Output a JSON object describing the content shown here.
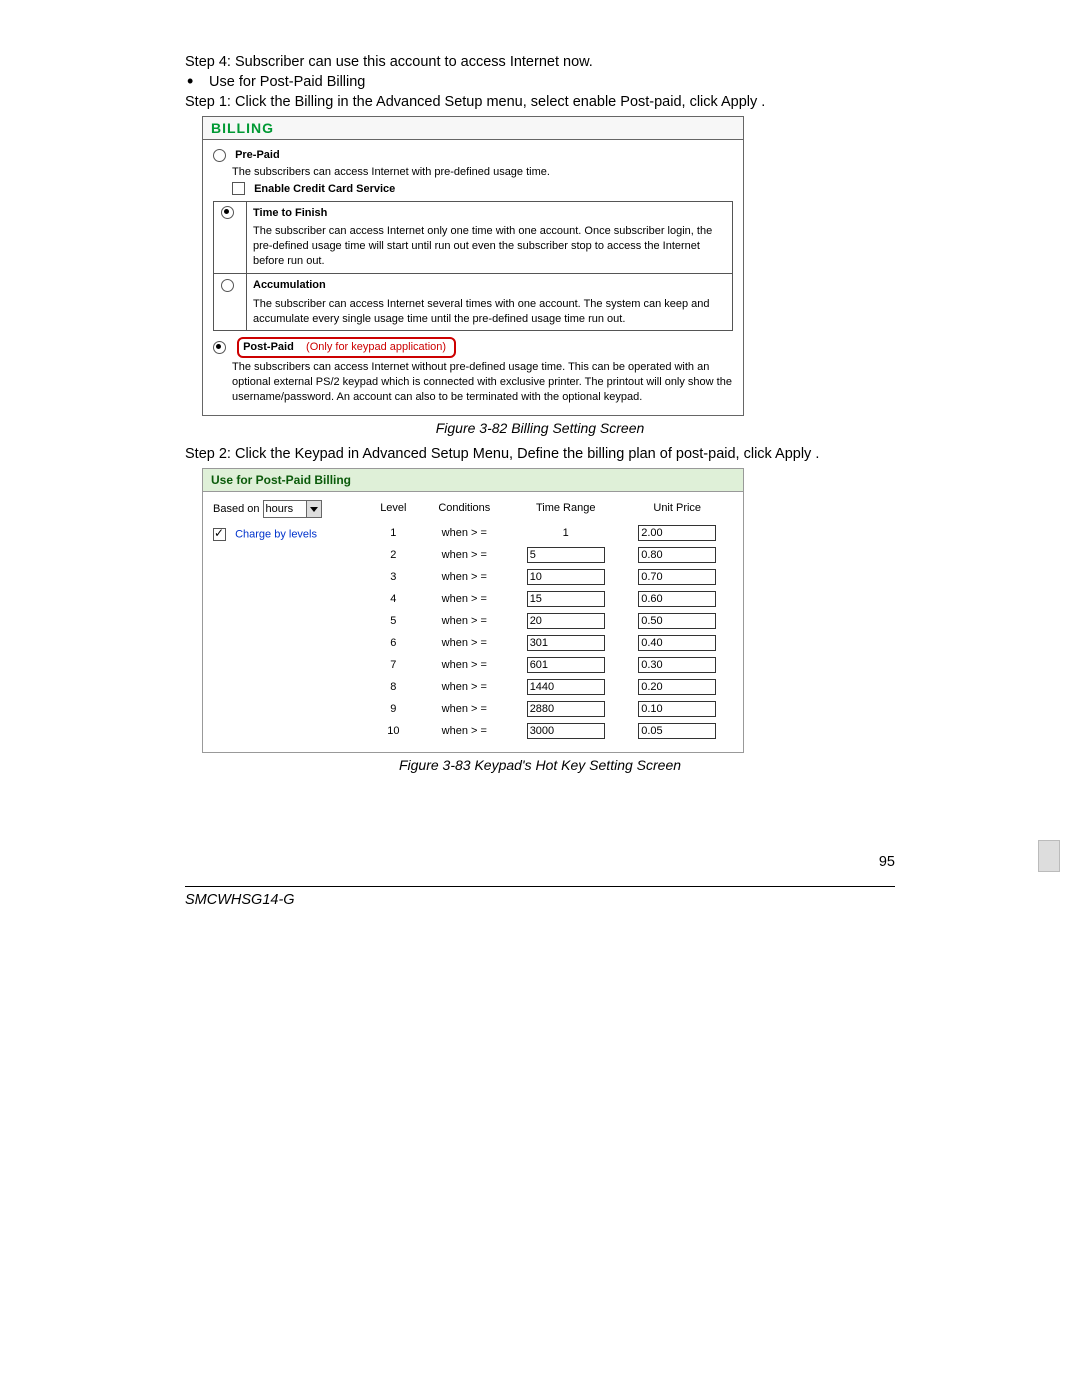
{
  "intro": {
    "step4": "Step 4: Subscriber can use this account to access Internet now.",
    "bullet": "Use for Post-Paid Billing",
    "step1": "Step 1: Click the Billing in the Advanced Setup menu, select enable Post-paid, click Apply ."
  },
  "billing": {
    "header": "BILLING",
    "prepaid_label": "Pre-Paid",
    "prepaid_desc": "The subscribers can access Internet with pre-defined usage time.",
    "enable_cc": "Enable Credit Card Service",
    "options": [
      {
        "title": "Time to Finish",
        "selected": true,
        "desc": "The subscriber can access Internet only one time with one account.  Once subscriber login, the pre-defined usage time will start until run out even the subscriber stop to access the Internet before run out."
      },
      {
        "title": "Accumulation",
        "selected": false,
        "desc": "The subscriber can access Internet several times with one account.  The system can keep and accumulate every single usage time until the pre-defined usage time run out."
      }
    ],
    "postpaid_label": "Post-Paid",
    "postpaid_note": "(Only for keypad application)",
    "postpaid_desc": "The subscribers can access Internet without pre-defined usage time. This can be operated with an optional external PS/2 keypad which is connected with exclusive printer. The printout will only show the username/password. An account can also to be terminated with the optional keypad."
  },
  "fig82": "Figure 3-82 Billing Setting Screen",
  "step2": "Step 2: Click the Keypad in Advanced Setup Menu, Define the billing plan of post-paid, click Apply .",
  "keypad": {
    "header": "Use for Post-Paid Billing",
    "based_on_label": "Based on",
    "based_on_value": "hours",
    "charge_label": "Charge by levels",
    "cols": {
      "a": "Level",
      "b": "Conditions",
      "c": "Time Range",
      "d": "Unit Price"
    },
    "cond": "when  > =",
    "rows": [
      {
        "level": "1",
        "range": "1",
        "range_is_static": true,
        "price": "2.00"
      },
      {
        "level": "2",
        "range": "5",
        "range_is_static": false,
        "price": "0.80"
      },
      {
        "level": "3",
        "range": "10",
        "range_is_static": false,
        "price": "0.70"
      },
      {
        "level": "4",
        "range": "15",
        "range_is_static": false,
        "price": "0.60"
      },
      {
        "level": "5",
        "range": "20",
        "range_is_static": false,
        "price": "0.50"
      },
      {
        "level": "6",
        "range": "301",
        "range_is_static": false,
        "price": "0.40"
      },
      {
        "level": "7",
        "range": "601",
        "range_is_static": false,
        "price": "0.30"
      },
      {
        "level": "8",
        "range": "1440",
        "range_is_static": false,
        "price": "0.20"
      },
      {
        "level": "9",
        "range": "2880",
        "range_is_static": false,
        "price": "0.10"
      },
      {
        "level": "10",
        "range": "3000",
        "range_is_static": false,
        "price": "0.05"
      }
    ]
  },
  "fig83": "Figure 3-83 Keypad's Hot Key Setting Screen",
  "page_number": "95",
  "model": "SMCWHSG14-G"
}
